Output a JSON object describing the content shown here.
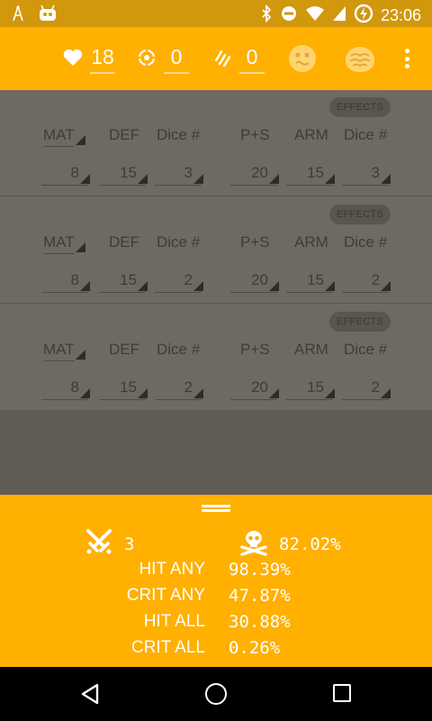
{
  "status_bar": {
    "time": "23:06",
    "icons": [
      "antenna-icon",
      "android-icon",
      "bluetooth-icon",
      "do-not-disturb-icon",
      "wifi-icon",
      "signal-icon",
      "battery-charging-icon"
    ]
  },
  "toolbar": {
    "health": "18",
    "focus": "0",
    "fury": "0",
    "icons": [
      "heart-icon",
      "target-icon",
      "claw-icon",
      "dead-face-icon",
      "brain-icon",
      "overflow-menu-icon"
    ]
  },
  "rows": [
    {
      "effects_label": "EFFECTS",
      "headers": {
        "mat": "MAT",
        "def": "DEF",
        "dice_a": "Dice #",
        "ps": "P+S",
        "arm": "ARM",
        "dice_b": "Dice #"
      },
      "values": {
        "mat": "8",
        "def": "15",
        "dice_a": "3",
        "ps": "20",
        "arm": "15",
        "dice_b": "3"
      }
    },
    {
      "effects_label": "EFFECTS",
      "headers": {
        "mat": "MAT",
        "def": "DEF",
        "dice_a": "Dice #",
        "ps": "P+S",
        "arm": "ARM",
        "dice_b": "Dice #"
      },
      "values": {
        "mat": "8",
        "def": "15",
        "dice_a": "2",
        "ps": "20",
        "arm": "15",
        "dice_b": "2"
      }
    },
    {
      "effects_label": "EFFECTS",
      "headers": {
        "mat": "MAT",
        "def": "DEF",
        "dice_a": "Dice #",
        "ps": "P+S",
        "arm": "ARM",
        "dice_b": "Dice #"
      },
      "values": {
        "mat": "8",
        "def": "15",
        "dice_a": "2",
        "ps": "20",
        "arm": "15",
        "dice_b": "2"
      }
    }
  ],
  "results": {
    "dice_total": "3",
    "kill_chance": "82.02%",
    "rows": [
      {
        "label": "HIT ANY",
        "value": "98.39%"
      },
      {
        "label": "CRIT ANY",
        "value": "47.87%"
      },
      {
        "label": "HIT ALL",
        "value": "30.88%"
      },
      {
        "label": "CRIT ALL",
        "value": "0.26%"
      }
    ]
  },
  "colors": {
    "accent": "#ffb000",
    "status_bar": "#d1970d",
    "dimmed_rows": "#6e6a63",
    "nav_bar": "#000000"
  }
}
